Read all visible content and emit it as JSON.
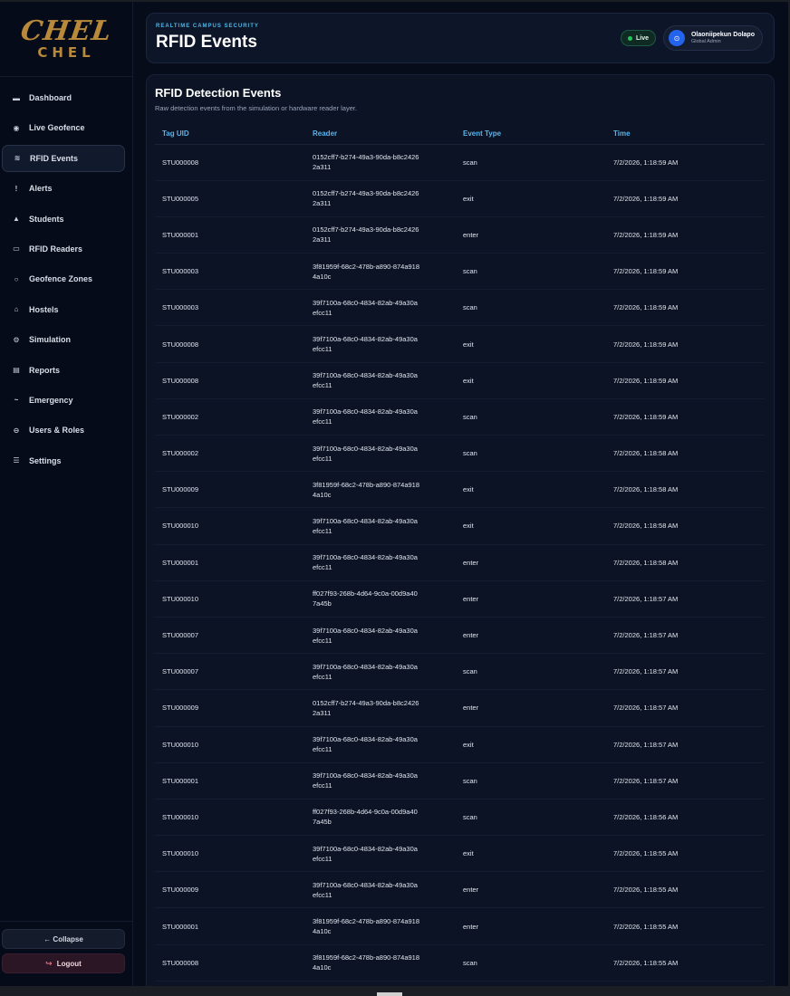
{
  "brand": {
    "mark": "CHEL",
    "word": "CHEL"
  },
  "sidebar": {
    "items": [
      {
        "label": "Dashboard",
        "icon": "dashboard-icon",
        "glyph": "▬",
        "active": false
      },
      {
        "label": "Live Geofence",
        "icon": "geofence-icon",
        "glyph": "◉",
        "active": false
      },
      {
        "label": "RFID Events",
        "icon": "rfid-icon",
        "glyph": "≋",
        "active": true
      },
      {
        "label": "Alerts",
        "icon": "alert-icon",
        "glyph": "!",
        "active": false
      },
      {
        "label": "Students",
        "icon": "students-icon",
        "glyph": "▲",
        "active": false
      },
      {
        "label": "RFID Readers",
        "icon": "reader-icon",
        "glyph": "▭",
        "active": false
      },
      {
        "label": "Geofence Zones",
        "icon": "zones-icon",
        "glyph": "○",
        "active": false
      },
      {
        "label": "Hostels",
        "icon": "hostel-icon",
        "glyph": "⌂",
        "active": false
      },
      {
        "label": "Simulation",
        "icon": "simulation-icon",
        "glyph": "⚙",
        "active": false
      },
      {
        "label": "Reports",
        "icon": "reports-icon",
        "glyph": "▤",
        "active": false
      },
      {
        "label": "Emergency",
        "icon": "emergency-icon",
        "glyph": "~",
        "active": false
      },
      {
        "label": "Users & Roles",
        "icon": "users-icon",
        "glyph": "⊖",
        "active": false
      },
      {
        "label": "Settings",
        "icon": "settings-icon",
        "glyph": "☰",
        "active": false
      }
    ],
    "collapse_label": "← Collapse",
    "logout_label": "Logout"
  },
  "header": {
    "eyebrow": "REALTIME CAMPUS SECURITY",
    "title": "RFID Events",
    "live_label": "Live",
    "user_name": "Olaoniipekun Dolapo",
    "user_role": "Global Admin"
  },
  "card": {
    "title": "RFID Detection Events",
    "subtitle": "Raw detection events from the simulation or hardware reader layer."
  },
  "table": {
    "columns": [
      "Tag UID",
      "Reader",
      "Event Type",
      "Time"
    ],
    "rows": [
      [
        "STU000008",
        "0152cff7-b274-49a3-90da-b8c24262a311",
        "scan",
        "7/2/2026, 1:18:59 AM"
      ],
      [
        "STU000005",
        "0152cff7-b274-49a3-90da-b8c24262a311",
        "exit",
        "7/2/2026, 1:18:59 AM"
      ],
      [
        "STU000001",
        "0152cff7-b274-49a3-90da-b8c24262a311",
        "enter",
        "7/2/2026, 1:18:59 AM"
      ],
      [
        "STU000003",
        "3f81959f-68c2-478b-a890-874a9184a10c",
        "scan",
        "7/2/2026, 1:18:59 AM"
      ],
      [
        "STU000003",
        "39f7100a-68c0-4834-82ab-49a30aefcc11",
        "scan",
        "7/2/2026, 1:18:59 AM"
      ],
      [
        "STU000008",
        "39f7100a-68c0-4834-82ab-49a30aefcc11",
        "exit",
        "7/2/2026, 1:18:59 AM"
      ],
      [
        "STU000008",
        "39f7100a-68c0-4834-82ab-49a30aefcc11",
        "exit",
        "7/2/2026, 1:18:59 AM"
      ],
      [
        "STU000002",
        "39f7100a-68c0-4834-82ab-49a30aefcc11",
        "scan",
        "7/2/2026, 1:18:59 AM"
      ],
      [
        "STU000002",
        "39f7100a-68c0-4834-82ab-49a30aefcc11",
        "scan",
        "7/2/2026, 1:18:58 AM"
      ],
      [
        "STU000009",
        "3f81959f-68c2-478b-a890-874a9184a10c",
        "exit",
        "7/2/2026, 1:18:58 AM"
      ],
      [
        "STU000010",
        "39f7100a-68c0-4834-82ab-49a30aefcc11",
        "exit",
        "7/2/2026, 1:18:58 AM"
      ],
      [
        "STU000001",
        "39f7100a-68c0-4834-82ab-49a30aefcc11",
        "enter",
        "7/2/2026, 1:18:58 AM"
      ],
      [
        "STU000010",
        "ff027f93-268b-4d64-9c0a-00d9a407a45b",
        "enter",
        "7/2/2026, 1:18:57 AM"
      ],
      [
        "STU000007",
        "39f7100a-68c0-4834-82ab-49a30aefcc11",
        "enter",
        "7/2/2026, 1:18:57 AM"
      ],
      [
        "STU000007",
        "39f7100a-68c0-4834-82ab-49a30aefcc11",
        "scan",
        "7/2/2026, 1:18:57 AM"
      ],
      [
        "STU000009",
        "0152cff7-b274-49a3-90da-b8c24262a311",
        "enter",
        "7/2/2026, 1:18:57 AM"
      ],
      [
        "STU000010",
        "39f7100a-68c0-4834-82ab-49a30aefcc11",
        "exit",
        "7/2/2026, 1:18:57 AM"
      ],
      [
        "STU000001",
        "39f7100a-68c0-4834-82ab-49a30aefcc11",
        "scan",
        "7/2/2026, 1:18:57 AM"
      ],
      [
        "STU000010",
        "ff027f93-268b-4d64-9c0a-00d9a407a45b",
        "scan",
        "7/2/2026, 1:18:56 AM"
      ],
      [
        "STU000010",
        "39f7100a-68c0-4834-82ab-49a30aefcc11",
        "exit",
        "7/2/2026, 1:18:55 AM"
      ],
      [
        "STU000009",
        "39f7100a-68c0-4834-82ab-49a30aefcc11",
        "enter",
        "7/2/2026, 1:18:55 AM"
      ],
      [
        "STU000001",
        "3f81959f-68c2-478b-a890-874a9184a10c",
        "enter",
        "7/2/2026, 1:18:55 AM"
      ],
      [
        "STU000008",
        "3f81959f-68c2-478b-a890-874a9184a10c",
        "scan",
        "7/2/2026, 1:18:55 AM"
      ]
    ]
  }
}
